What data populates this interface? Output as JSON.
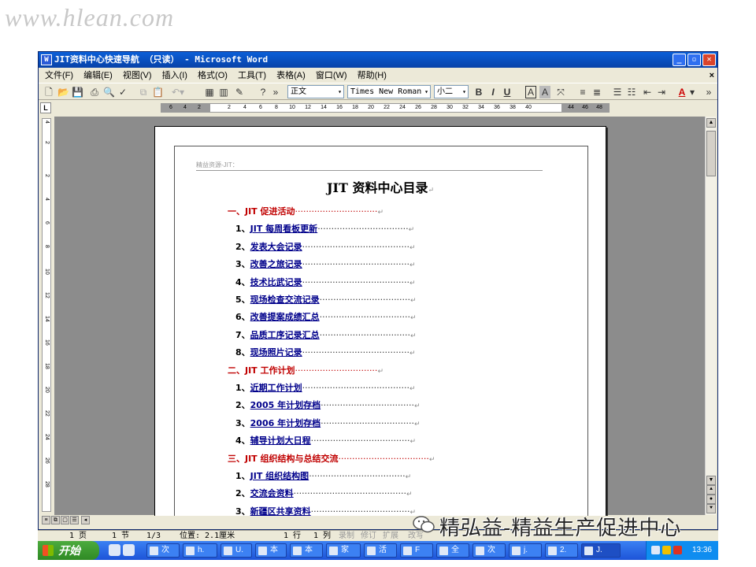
{
  "watermark": "www.hlean.com",
  "window": {
    "title": "JIT资料中心快速导航 （只读） - Microsoft Word",
    "app_icon": "W"
  },
  "menu": [
    "文件(F)",
    "编辑(E)",
    "视图(V)",
    "插入(I)",
    "格式(O)",
    "工具(T)",
    "表格(A)",
    "窗口(W)",
    "帮助(H)"
  ],
  "menu_close": "×",
  "toolbar": {
    "style": "正文",
    "font": "Times New Roman",
    "size": "小二",
    "bold": "B",
    "italic": "I",
    "underline": "U",
    "char_border": "A",
    "char_shading": "A",
    "font_color": "A"
  },
  "ruler": {
    "corner": "L",
    "ticks": [
      "6",
      "4",
      "2",
      "2",
      "4",
      "6",
      "8",
      "10",
      "12",
      "14",
      "16",
      "18",
      "20",
      "22",
      "24",
      "26",
      "28",
      "30",
      "32",
      "34",
      "36",
      "38",
      "40",
      "44",
      "46",
      "48"
    ]
  },
  "vruler": [
    "4",
    "2",
    "2",
    "4",
    "6",
    "8",
    "10",
    "12",
    "14",
    "16",
    "18",
    "20",
    "22",
    "24",
    "26",
    "28"
  ],
  "document": {
    "header": "精益资源-JIT：",
    "title": "JIT 资料中心目录",
    "para_mark": "↵",
    "toc": [
      {
        "kind": "section",
        "num": "一、",
        "label": "JIT 促进活动",
        "dots": "······························"
      },
      {
        "kind": "item",
        "num": "1、",
        "label": "JIT 每周看板更新",
        "dots": "·································"
      },
      {
        "kind": "item",
        "num": "2、",
        "label": "发表大会记录",
        "dots": "·······································"
      },
      {
        "kind": "item",
        "num": "3、",
        "label": "改善之旅记录",
        "dots": "·······································"
      },
      {
        "kind": "item",
        "num": "4、",
        "label": "技术比武记录",
        "dots": "·······································"
      },
      {
        "kind": "item",
        "num": "5、",
        "label": "现场检查交流记录",
        "dots": "·································"
      },
      {
        "kind": "item",
        "num": "6、",
        "label": "改善提案成绩汇总",
        "dots": "·································"
      },
      {
        "kind": "item",
        "num": "7、",
        "label": "品质工序记录汇总",
        "dots": "·································"
      },
      {
        "kind": "item",
        "num": "8、",
        "label": "现场照片记录",
        "dots": "·······································"
      },
      {
        "kind": "section",
        "num": "二、",
        "label": "JIT 工作计划",
        "dots": "······························"
      },
      {
        "kind": "item",
        "num": "1、",
        "label": "近期工作计划",
        "dots": "·······································"
      },
      {
        "kind": "item",
        "num": "2、",
        "label": "2005 年计划存档",
        "dots": "··································"
      },
      {
        "kind": "item",
        "num": "3、",
        "label": "2006 年计划存档",
        "dots": "··································"
      },
      {
        "kind": "item",
        "num": "4、",
        "label": "辅导计划大日程",
        "dots": "····································"
      },
      {
        "kind": "section",
        "num": "三、",
        "label": "JIT 组织结构与总结交流",
        "dots": "·································"
      },
      {
        "kind": "item",
        "num": "1、",
        "label": "JIT 组织结构图",
        "dots": "···································"
      },
      {
        "kind": "item",
        "num": "2、",
        "label": "交流会资料",
        "dots": "·········································"
      },
      {
        "kind": "item",
        "num": "3、",
        "label": "新疆区共享资料",
        "dots": "····································"
      }
    ]
  },
  "status": {
    "page": "1 页",
    "section": "1 节",
    "of": "1/3",
    "position": "位置: 2.1厘米",
    "line": "1 行",
    "col": "1 列",
    "rec": "录制",
    "trk": "修订",
    "ext": "扩展",
    "ovr": "改写"
  },
  "taskbar": {
    "start": "开始",
    "tasks": [
      "次",
      "h.",
      "U.",
      "本",
      "本",
      "家",
      "活",
      "F",
      "全",
      "次",
      "j.",
      "2.",
      "J."
    ],
    "clock": "13:36"
  },
  "brand": "精弘益-精益生产促进中心"
}
